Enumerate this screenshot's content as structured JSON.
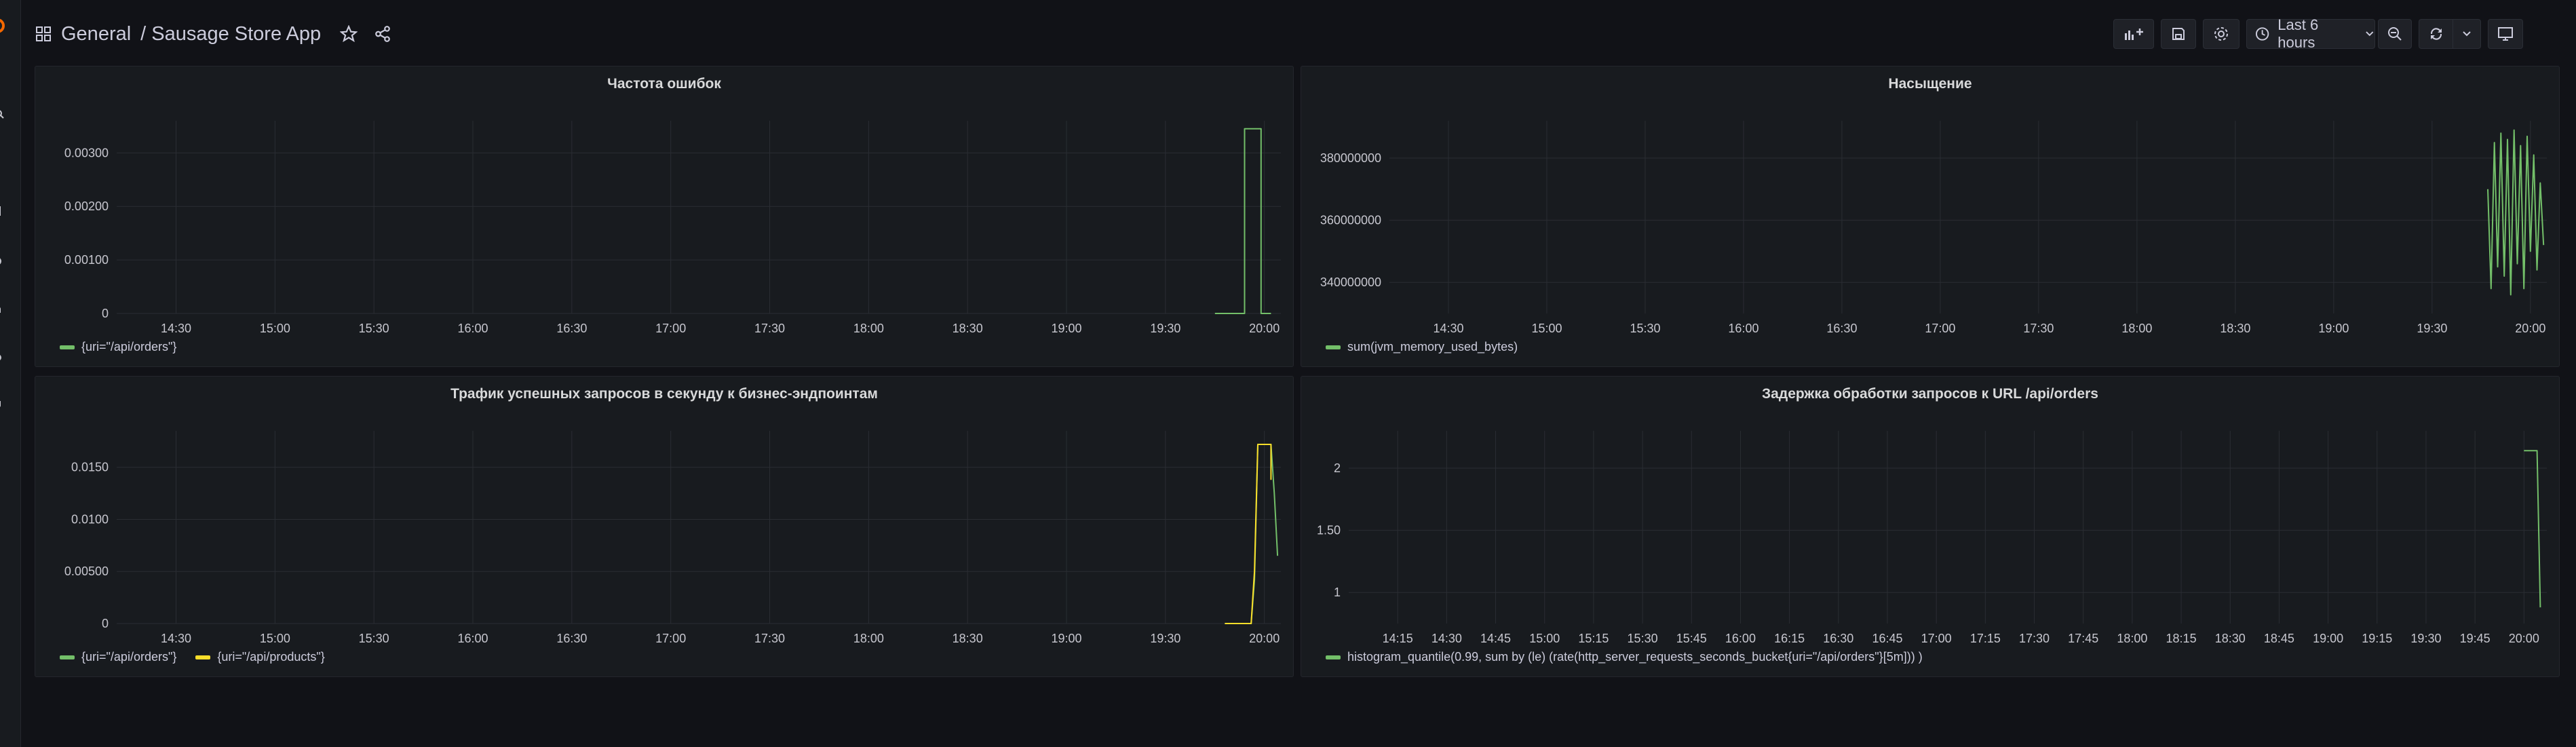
{
  "breadcrumb": {
    "folder": "General",
    "separator": "/",
    "dashboard": "Sausage Store App"
  },
  "toolbar": {
    "time_range": "Last 6 hours"
  },
  "colors": {
    "green": "#73bf69",
    "yellow": "#fade2a",
    "grid": "#2a2d33"
  },
  "panels": [
    {
      "title": "Частота ошибок",
      "legend": [
        {
          "label": "{uri=\"/api/orders\"}",
          "color": "#73bf69"
        }
      ]
    },
    {
      "title": "Насыщение",
      "legend": [
        {
          "label": "sum(jvm_memory_used_bytes)",
          "color": "#73bf69"
        }
      ]
    },
    {
      "title": "Трафик успешных запросов в секунду к бизнес-эндпоинтам",
      "legend": [
        {
          "label": "{uri=\"/api/orders\"}",
          "color": "#73bf69"
        },
        {
          "label": "{uri=\"/api/products\"}",
          "color": "#fade2a"
        }
      ]
    },
    {
      "title": "Задержка обработки запросов к URL /api/orders",
      "legend": [
        {
          "label": "histogram_quantile(0.99, sum by (le) (rate(http_server_requests_seconds_bucket{uri=\"/api/orders\"}[5m])) )",
          "color": "#73bf69"
        }
      ]
    }
  ],
  "chart_data": [
    {
      "type": "line",
      "title": "Частота ошибок",
      "x_ticks": [
        "14:30",
        "15:00",
        "15:30",
        "16:00",
        "16:30",
        "17:00",
        "17:30",
        "18:00",
        "18:30",
        "19:00",
        "19:30",
        "20:00"
      ],
      "y_ticks": [
        "0",
        "0.00100",
        "0.00200",
        "0.00300"
      ],
      "ylim": [
        0,
        0.0036
      ],
      "xlim": [
        "14:12",
        "20:05"
      ],
      "series": [
        {
          "name": "{uri=\"/api/orders\"}",
          "color": "#73bf69",
          "x": [
            "19:45",
            "19:54",
            "19:54",
            "19:59",
            "19:59",
            "20:02"
          ],
          "y": [
            0,
            0,
            0.00345,
            0.00345,
            0,
            0
          ]
        }
      ]
    },
    {
      "type": "line",
      "title": "Насыщение",
      "x_ticks": [
        "14:30",
        "15:00",
        "15:30",
        "16:00",
        "16:30",
        "17:00",
        "17:30",
        "18:00",
        "18:30",
        "19:00",
        "19:30",
        "20:00"
      ],
      "y_ticks": [
        "340000000",
        "360000000",
        "380000000"
      ],
      "ylim": [
        330000000,
        392000000
      ],
      "xlim": [
        "14:12",
        "20:05"
      ],
      "series": [
        {
          "name": "sum(jvm_memory_used_bytes)",
          "color": "#73bf69",
          "x": [
            "19:47",
            "19:48",
            "19:49",
            "19:50",
            "19:51",
            "19:52",
            "19:53",
            "19:54",
            "19:55",
            "19:56",
            "19:57",
            "19:58",
            "19:59",
            "20:00",
            "20:01",
            "20:02",
            "20:03",
            "20:04"
          ],
          "y": [
            370000000,
            338000000,
            385000000,
            345000000,
            388000000,
            342000000,
            386000000,
            336000000,
            389000000,
            346000000,
            384000000,
            338000000,
            387000000,
            350000000,
            381000000,
            344000000,
            372000000,
            352000000
          ]
        }
      ]
    },
    {
      "type": "line",
      "title": "Трафик успешных запросов в секунду к бизнес-эндпоинтам",
      "x_ticks": [
        "14:30",
        "15:00",
        "15:30",
        "16:00",
        "16:30",
        "17:00",
        "17:30",
        "18:00",
        "18:30",
        "19:00",
        "19:30",
        "20:00"
      ],
      "y_ticks": [
        "0",
        "0.00500",
        "0.0100",
        "0.0150"
      ],
      "ylim": [
        0,
        0.0185
      ],
      "xlim": [
        "14:12",
        "20:05"
      ],
      "series": [
        {
          "name": "{uri=\"/api/orders\"}",
          "color": "#73bf69",
          "x": [
            "19:48",
            "19:56",
            "19:57",
            "19:58",
            "20:02",
            "20:03",
            "20:04"
          ],
          "y": [
            0,
            0,
            0.0042,
            0.0172,
            0.0172,
            0.0125,
            0.0065
          ]
        },
        {
          "name": "{uri=\"/api/products\"}",
          "color": "#fade2a",
          "x": [
            "19:48",
            "19:56",
            "19:57",
            "19:58",
            "20:02",
            "20:02"
          ],
          "y": [
            0,
            0,
            0.005,
            0.0172,
            0.0172,
            0.0138
          ]
        }
      ]
    },
    {
      "type": "line",
      "title": "Задержка обработки запросов к URL /api/orders",
      "x_ticks": [
        "14:15",
        "14:30",
        "14:45",
        "15:00",
        "15:15",
        "15:30",
        "15:45",
        "16:00",
        "16:15",
        "16:30",
        "16:45",
        "17:00",
        "17:15",
        "17:30",
        "17:45",
        "18:00",
        "18:15",
        "18:30",
        "18:45",
        "19:00",
        "19:15",
        "19:30",
        "19:45",
        "20:00"
      ],
      "y_ticks": [
        "1",
        "1.50",
        "2"
      ],
      "ylim": [
        0.75,
        2.3
      ],
      "xlim": [
        "14:00",
        "20:07"
      ],
      "series": [
        {
          "name": "histogram_quantile(0.99, sum by (le) (rate(http_server_requests_seconds_bucket{uri=\"/api/orders\"}[5m])) )",
          "color": "#73bf69",
          "x": [
            "20:00",
            "20:04",
            "20:05"
          ],
          "y": [
            2.14,
            2.14,
            0.88
          ]
        }
      ]
    }
  ]
}
